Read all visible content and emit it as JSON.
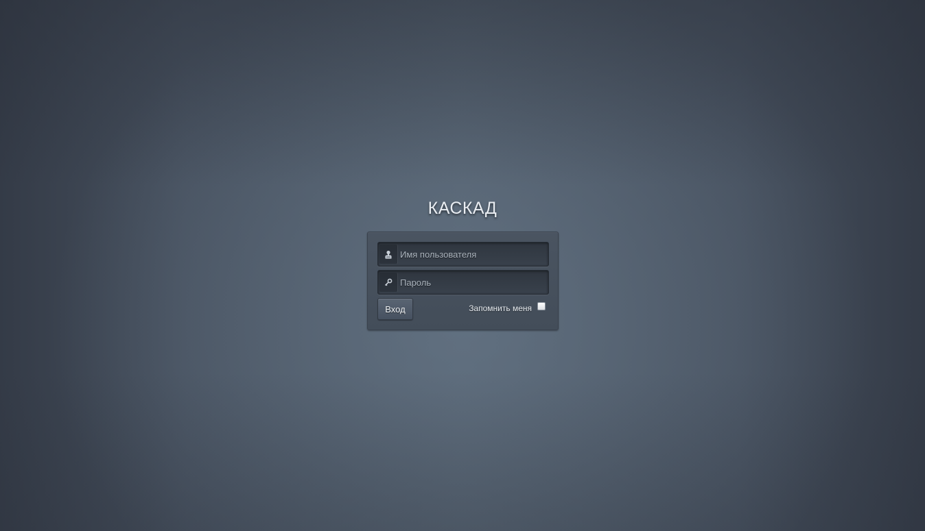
{
  "app": {
    "title": "КАСКАД"
  },
  "login_form": {
    "username": {
      "placeholder": "Имя пользователя",
      "value": "",
      "icon": "user-icon"
    },
    "password": {
      "placeholder": "Пароль",
      "value": "",
      "icon": "key-icon"
    },
    "submit_label": "Вход",
    "remember_label": "Запомнить меня",
    "remember_checked": false
  },
  "colors": {
    "background_center": "#566472",
    "background_edge": "#343b47",
    "panel": "#47515d",
    "field": "#333a44",
    "title_text": "#e9edf2"
  }
}
